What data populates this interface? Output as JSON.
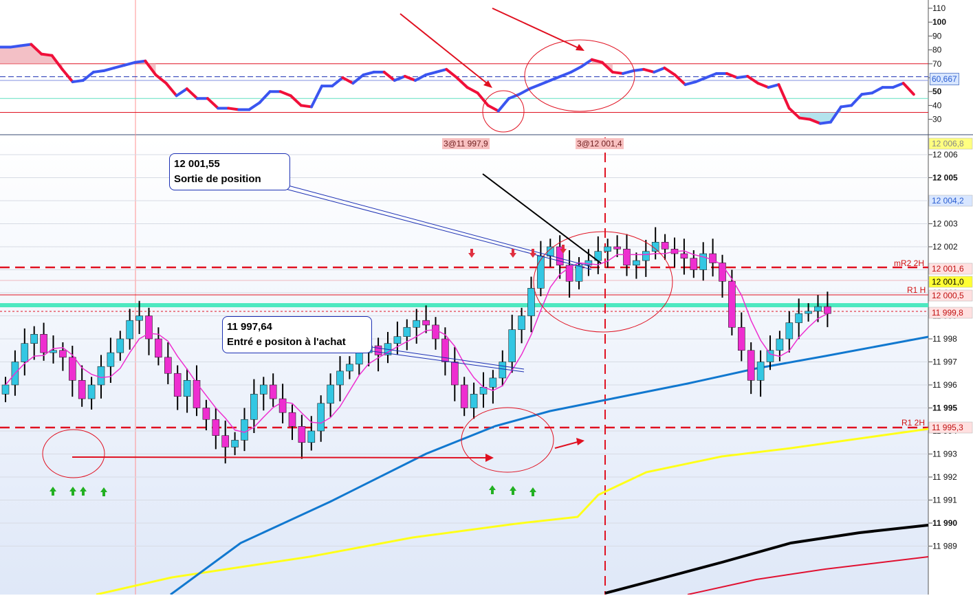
{
  "colors": {
    "bull": "#33c7e3",
    "bear": "#ee2ed0",
    "ma_fast": "#ee2ed0",
    "ma_blue": "#1178cf",
    "ma_yellow": "#ffff1a",
    "ma_black": "#000000",
    "ma_red": "#e01030",
    "rsi_up": "#3a55f0",
    "rsi_down": "#f0103a",
    "level_line": "#e01020",
    "pivot_green": "#4de8c0"
  },
  "rsi": {
    "axis_labels": [
      "110",
      "100",
      "90",
      "80",
      "70",
      "60",
      "50",
      "40",
      "30"
    ],
    "current_value": "60,667",
    "trade_labels": [
      "3@11 997,9",
      "3@12 001,4"
    ]
  },
  "price": {
    "axis_labels": [
      "12 006",
      "12 005",
      "12 004",
      "12 003",
      "12 002",
      "12 001",
      "12 000",
      "11 999",
      "11 998",
      "11 997",
      "11 996",
      "11 995",
      "11 994",
      "11 993",
      "11 992",
      "11 991",
      "11 990",
      "11 989"
    ],
    "level_tags": [
      {
        "text": "12 006,8",
        "bg": "#ffff80",
        "fg": "#888"
      },
      {
        "text": "12 004,2",
        "bg": "#d8e6ff",
        "fg": "#2a5dd0"
      },
      {
        "text": "12 001,6",
        "bg": "#ffe0e0",
        "fg": "#c01010"
      },
      {
        "text": "12 001,0",
        "bg": "#ffff33",
        "fg": "#000"
      },
      {
        "text": "12 000,5",
        "bg": "#ffe0e0",
        "fg": "#c01010"
      },
      {
        "text": "11 999,8",
        "bg": "#ffe0e0",
        "fg": "#c01010"
      },
      {
        "text": "11 995,3",
        "bg": "#ffe0e0",
        "fg": "#c01010"
      }
    ],
    "level_names": [
      "mR2 2H",
      "R1 H",
      "R1 2H"
    ]
  },
  "annotations": {
    "exit_price": "12 001,55",
    "exit_text": "Sortie de position",
    "entry_price": "11 997,64",
    "entry_text": "Entré e positon à l'achat"
  },
  "chart_data": {
    "type": "candlestick",
    "bar_count": 97,
    "closes": [
      11996.0,
      11997.0,
      11997.8,
      11998.2,
      11997.4,
      11997.5,
      11997.2,
      11996.2,
      11995.4,
      11996.0,
      11996.8,
      11997.4,
      11998.0,
      11998.8,
      11999.0,
      11998.0,
      11997.2,
      11996.5,
      11995.5,
      11996.2,
      11995.0,
      11994.5,
      11993.8,
      11993.3,
      11993.6,
      11994.5,
      11995.6,
      11996.0,
      11995.4,
      11994.8,
      11994.2,
      11993.5,
      11994.0,
      11995.2,
      11996.0,
      11996.6,
      11996.9,
      11997.4,
      11997.7,
      11997.3,
      11997.8,
      11998.1,
      11998.5,
      11998.8,
      11998.6,
      11998.0,
      11997.0,
      11996.0,
      11995.0,
      11995.6,
      11995.9,
      11996.3,
      11997.0,
      11998.4,
      11999.0,
      12000.2,
      12001.6,
      12002.0,
      12001.2,
      12000.5,
      12001.2,
      12001.4,
      12001.8,
      12002.0,
      12001.9,
      12001.2,
      12001.4,
      12001.8,
      12002.2,
      12001.9,
      12001.7,
      12001.5,
      12001.0,
      12001.7,
      12001.3,
      12000.5,
      11998.5,
      11997.5,
      11996.2,
      11997.0,
      11997.5,
      11998.0,
      11998.7,
      11999.1,
      11999.2,
      11999.4,
      11999.1
    ],
    "y_axis_label": "price",
    "ylim": [
      11988.8,
      12006.9
    ],
    "horizontal_levels": [
      {
        "name": "mR2 2H",
        "value": 12001.6
      },
      {
        "name": "R1 H",
        "value": 12000.5
      },
      {
        "name": "R1 2H",
        "value": 11995.3
      }
    ],
    "rsi_ylim": [
      20,
      115
    ],
    "rsi_bands": [
      70,
      35
    ],
    "rsi_values": [
      82,
      82,
      83,
      84,
      77,
      76,
      66,
      57,
      58,
      64,
      65,
      67,
      69,
      71,
      72,
      62,
      56,
      47,
      52,
      45,
      45,
      38,
      38,
      37,
      37,
      42,
      50,
      50,
      47,
      40,
      39,
      54,
      54,
      60,
      56,
      62,
      64,
      64,
      58,
      61,
      58,
      62,
      64,
      66,
      60,
      53,
      49,
      40,
      36,
      45,
      48,
      52,
      55,
      58,
      61,
      64,
      68,
      73,
      71,
      64,
      63,
      65,
      66,
      64,
      67,
      62,
      55,
      57,
      60,
      63,
      63,
      60,
      61,
      56,
      53,
      55,
      38,
      31,
      30,
      27,
      28,
      39,
      40,
      48,
      49,
      53,
      53,
      56,
      48
    ]
  }
}
